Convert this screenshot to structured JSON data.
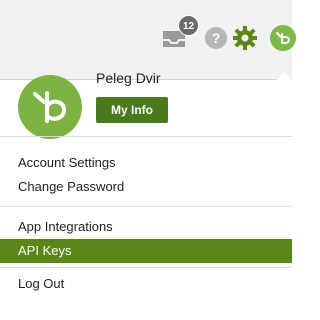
{
  "topbar": {
    "inbox_icon": "inbox-icon",
    "notification_count": "12",
    "help_label": "?",
    "help_icon": "help-icon",
    "settings_icon": "gear-icon",
    "avatar_icon": "bamboohr-logo-icon"
  },
  "profile": {
    "name": "Peleg Dvir",
    "my_info_label": "My Info"
  },
  "menu": {
    "items": [
      {
        "label": "Account Settings"
      },
      {
        "label": "Change Password"
      },
      {
        "label": "App Integrations"
      },
      {
        "label": "API Keys",
        "active": true
      },
      {
        "label": "Log Out"
      }
    ]
  },
  "colors": {
    "brand_green": "#7cb342",
    "button_green": "#4a7a1d",
    "active_green": "#5b8618"
  }
}
